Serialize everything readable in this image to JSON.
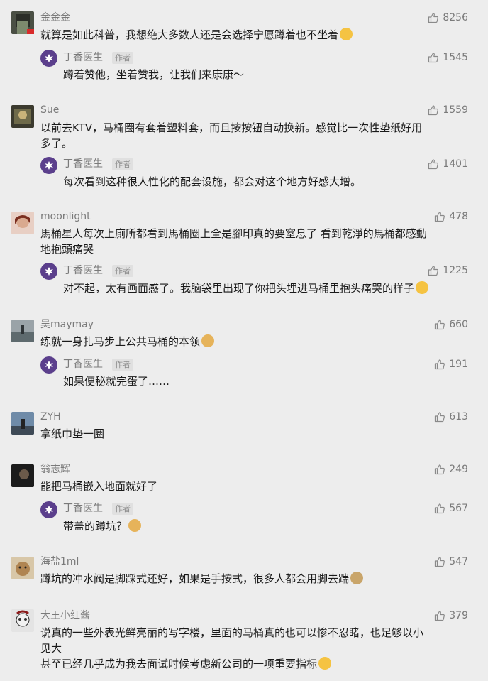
{
  "author_tag": "作者",
  "reply_author": "丁香医生",
  "colors": {
    "background": "#ededed",
    "text": "#1a1a1a",
    "meta": "#7a7a7a",
    "reply_avatar": "#5b3f8c"
  },
  "comments": [
    {
      "nickname": "金金金",
      "likes": "8256",
      "lines": [
        "就算是如此科普，我想绝大多数人还是会选择宁愿蹲着也不坐着"
      ],
      "emoji": "thinking-emoji",
      "reply": {
        "text": "蹲着赞他，坐着赞我，让我们来康康～",
        "likes": "1545"
      }
    },
    {
      "nickname": "Sue",
      "likes": "1559",
      "lines": [
        "以前去KTV，马桶圈有套着塑料套，而且按按钮自动换新。感觉比一次性垫纸好用",
        "多了。"
      ],
      "reply": {
        "text": "每次看到这种很人性化的配套设施，都会对这个地方好感大增。",
        "likes": "1401"
      }
    },
    {
      "nickname": "moonlight",
      "likes": "478",
      "lines": [
        "馬桶星人每次上廁所都看到馬桶圈上全是腳印真的要窒息了 看到乾淨的馬桶都感動",
        "地抱頭痛哭"
      ],
      "reply": {
        "text": "对不起，太有画面感了。我脑袋里出现了你把头埋进马桶里抱头痛哭的样子",
        "likes": "1225",
        "emoji": "crying-emoji"
      }
    },
    {
      "nickname": "吴maymay",
      "likes": "660",
      "lines": [
        "练就一身扎马步上公共马桶的本领"
      ],
      "emoji": "doge-emoji",
      "reply": {
        "text": "如果便秘就完蛋了……",
        "likes": "191"
      }
    },
    {
      "nickname": "ZYH",
      "likes": "613",
      "lines": [
        "拿纸巾垫一圈"
      ]
    },
    {
      "nickname": "翁志辉",
      "likes": "249",
      "lines": [
        "能把马桶嵌入地面就好了"
      ],
      "reply": {
        "text": "带盖的蹲坑？",
        "likes": "567",
        "emoji": "doge-emoji"
      }
    },
    {
      "nickname": "海盐1ml",
      "likes": "547",
      "lines": [
        "蹲坑的冲水阀是脚踩式还好，如果是手按式，很多人都会用脚去踹"
      ],
      "emoji": "kick-emoji"
    },
    {
      "nickname": "大王小红酱",
      "likes": "379",
      "lines": [
        "说真的一些外表光鲜亮丽的写字楼，里面的马桶真的也可以惨不忍睹，也足够以小",
        "见大",
        "甚至已经几乎成为我去面试时候考虑新公司的一项重要指标"
      ],
      "emoji_last": "smile-emoji"
    }
  ]
}
